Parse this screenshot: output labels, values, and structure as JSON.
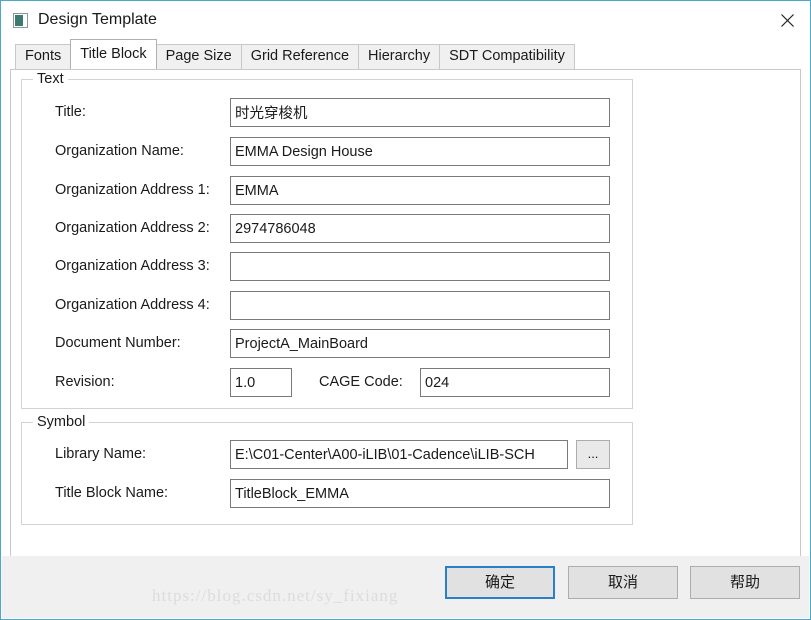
{
  "window": {
    "title": "Design Template",
    "icon": "app-window-icon",
    "close_label": "✕",
    "accent_color": "#4aa8c8"
  },
  "tabs": [
    {
      "label": "Fonts",
      "active": false
    },
    {
      "label": "Title Block",
      "active": true
    },
    {
      "label": "Page Size",
      "active": false
    },
    {
      "label": "Grid Reference",
      "active": false
    },
    {
      "label": "Hierarchy",
      "active": false
    },
    {
      "label": "SDT Compatibility",
      "active": false
    }
  ],
  "text_group": {
    "legend": "Text",
    "fields": [
      {
        "label": "Title:",
        "value": "时光穿梭机",
        "placeholder": ""
      },
      {
        "label": "Organization Name:",
        "value": "EMMA Design House",
        "placeholder": ""
      },
      {
        "label": "Organization Address 1:",
        "value": "EMMA",
        "placeholder": ""
      },
      {
        "label": "Organization Address 2:",
        "value": "2974786048",
        "placeholder": ""
      },
      {
        "label": "Organization Address 3:",
        "value": "",
        "placeholder": ""
      },
      {
        "label": "Organization Address 4:",
        "value": "",
        "placeholder": ""
      },
      {
        "label": "Document Number:",
        "value": "ProjectA_MainBoard",
        "placeholder": ""
      }
    ],
    "revision": {
      "label": "Revision:",
      "value": "1.0",
      "cage_label": "CAGE Code:",
      "cage_value": "024"
    }
  },
  "symbol_group": {
    "legend": "Symbol",
    "library_label": "Library Name:",
    "library_value": "E:\\C01-Center\\A00-iLIB\\01-Cadence\\iLIB-SCH",
    "browse_label": "...",
    "titleblock_label": "Title Block Name:",
    "titleblock_value": "TitleBlock_EMMA"
  },
  "footer": {
    "ok_label": "确定",
    "cancel_label": "取消",
    "help_label": "帮助",
    "watermark": "https://blog.csdn.net/sy_fixiang"
  }
}
